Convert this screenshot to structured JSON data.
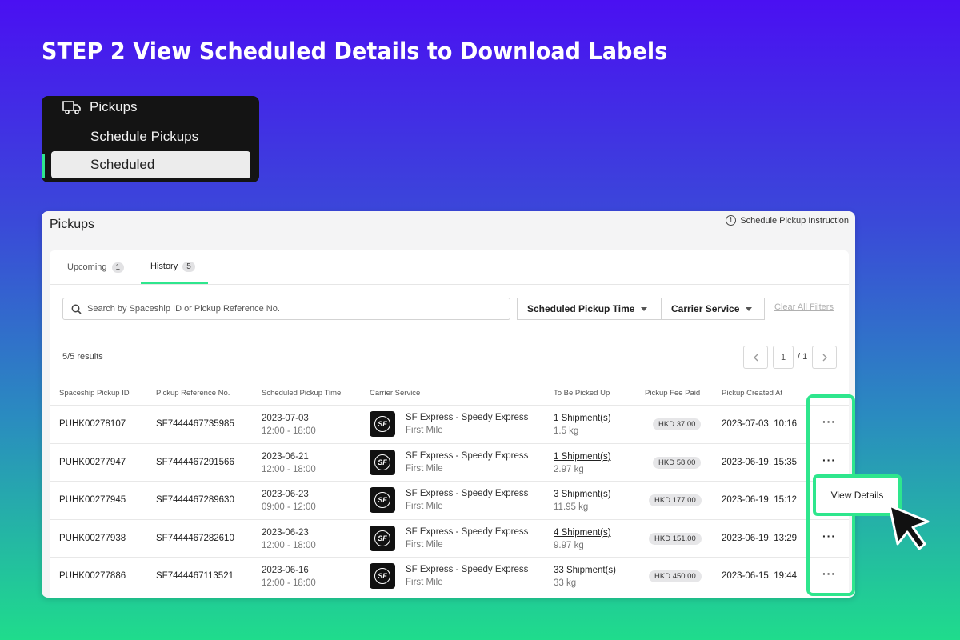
{
  "headline": "STEP 2 View Scheduled Details to Download Labels",
  "nav": {
    "section": "Pickups",
    "items": [
      "Schedule Pickups",
      "Scheduled"
    ],
    "active": "Scheduled"
  },
  "card": {
    "title": "Pickups",
    "instruction_link": "Schedule Pickup Instruction",
    "tabs": [
      {
        "label": "Upcoming",
        "count": "1"
      },
      {
        "label": "History",
        "count": "5"
      }
    ],
    "search_placeholder": "Search by Spaceship ID or Pickup Reference No.",
    "filters": [
      "Scheduled Pickup Time",
      "Carrier Service"
    ],
    "clear_filters": "Clear All Filters",
    "results": "5/5 results",
    "page": "1",
    "page_total": "/ 1",
    "columns": [
      "Spaceship Pickup ID",
      "Pickup Reference No.",
      "Scheduled Pickup Time",
      "Carrier Service",
      "To Be Picked Up",
      "Pickup Fee Paid",
      "Pickup Created At"
    ],
    "rows": [
      {
        "id": "PUHK00278107",
        "ref": "SF7444467735985",
        "date": "2023-07-03",
        "time": "12:00 - 18:00",
        "carrier": "SF Express - Speedy Express",
        "mile": "First Mile",
        "shipments": "1 Shipment(s)",
        "weight": "1.5 kg",
        "fee": "HKD 37.00",
        "created": "2023-07-03, 10:16",
        "action": "···"
      },
      {
        "id": "PUHK00277947",
        "ref": "SF7444467291566",
        "date": "2023-06-21",
        "time": "12:00 - 18:00",
        "carrier": "SF Express - Speedy Express",
        "mile": "First Mile",
        "shipments": "1 Shipment(s)",
        "weight": "2.97 kg",
        "fee": "HKD 58.00",
        "created": "2023-06-19, 15:35",
        "action": "···"
      },
      {
        "id": "PUHK00277945",
        "ref": "SF7444467289630",
        "date": "2023-06-23",
        "time": "09:00 - 12:00",
        "carrier": "SF Express - Speedy Express",
        "mile": "First Mile",
        "shipments": "3 Shipment(s)",
        "weight": "11.95 kg",
        "fee": "HKD 177.00",
        "created": "2023-06-19, 15:12",
        "action": ""
      },
      {
        "id": "PUHK00277938",
        "ref": "SF7444467282610",
        "date": "2023-06-23",
        "time": "12:00 - 18:00",
        "carrier": "SF Express - Speedy Express",
        "mile": "First Mile",
        "shipments": "4 Shipment(s)",
        "weight": "9.97 kg",
        "fee": "HKD 151.00",
        "created": "2023-06-19, 13:29",
        "action": "···"
      },
      {
        "id": "PUHK00277886",
        "ref": "SF7444467113521",
        "date": "2023-06-16",
        "time": "12:00 - 18:00",
        "carrier": "SF Express - Speedy Express",
        "mile": "First Mile",
        "shipments": "33 Shipment(s)",
        "weight": "33 kg",
        "fee": "HKD 450.00",
        "created": "2023-06-15, 19:44",
        "action": "···"
      }
    ],
    "logo_text": "SF",
    "view_details": "View Details"
  },
  "colors": {
    "accent": "#2ee68d",
    "sidebar_bg": "#141414"
  }
}
